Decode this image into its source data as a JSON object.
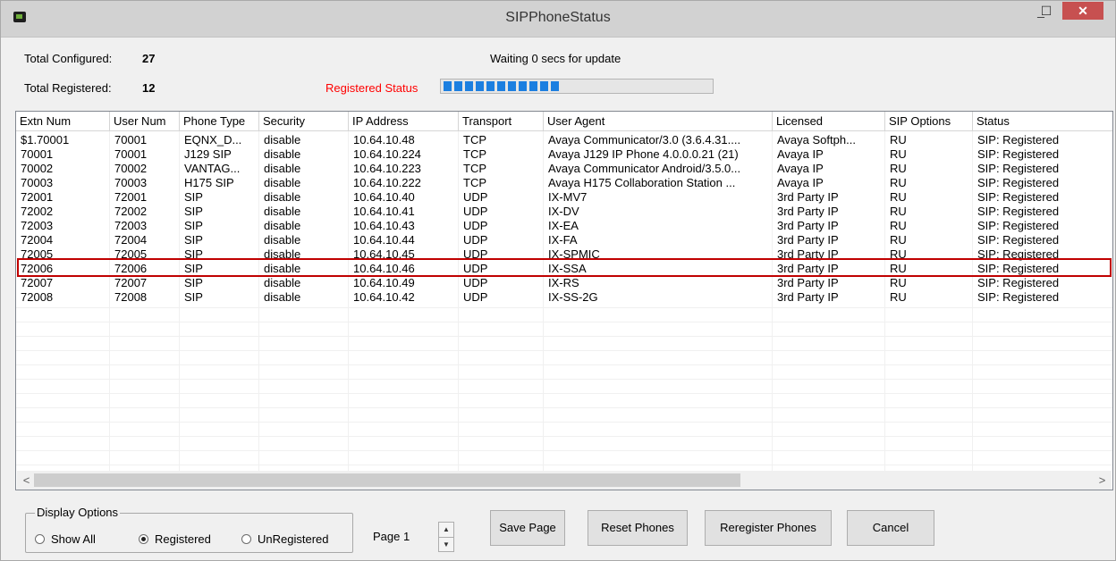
{
  "window": {
    "title": "SIPPhoneStatus",
    "minimize_glyph": "_",
    "maximize_glyph": "☐",
    "close_glyph": "✕"
  },
  "summary": {
    "total_configured_label": "Total Configured:",
    "total_configured_value": "27",
    "total_registered_label": "Total Registered:",
    "total_registered_value": "12",
    "waiting_text": "Waiting 0 secs for update",
    "registered_status_label": "Registered Status",
    "registered_status_color": "#ff0000",
    "progress_fraction": 0.44,
    "progress_color": "#1c7fe0"
  },
  "table": {
    "columns": [
      "Extn Num",
      "User Num",
      "Phone Type",
      "Security",
      "IP Address",
      "Transport",
      "User Agent",
      "Licensed",
      "SIP Options",
      "Status"
    ],
    "rows": [
      [
        "$1.70001",
        "70001",
        "EQNX_D...",
        "disable",
        "10.64.10.48",
        "TCP",
        "Avaya Communicator/3.0 (3.6.4.31....",
        "Avaya Softph...",
        "RU",
        "SIP: Registered"
      ],
      [
        "70001",
        "70001",
        "J129 SIP",
        "disable",
        "10.64.10.224",
        "TCP",
        "Avaya J129 IP Phone 4.0.0.0.21 (21)",
        "Avaya IP",
        "RU",
        "SIP: Registered"
      ],
      [
        "70002",
        "70002",
        "VANTAG...",
        "disable",
        "10.64.10.223",
        "TCP",
        "Avaya Communicator Android/3.5.0...",
        "Avaya IP",
        "RU",
        "SIP: Registered"
      ],
      [
        "70003",
        "70003",
        "H175 SIP",
        "disable",
        "10.64.10.222",
        "TCP",
        "Avaya H175 Collaboration Station ...",
        "Avaya IP",
        "RU",
        "SIP: Registered"
      ],
      [
        "72001",
        "72001",
        "SIP",
        "disable",
        "10.64.10.40",
        "UDP",
        "IX-MV7",
        "3rd Party IP",
        "RU",
        "SIP: Registered"
      ],
      [
        "72002",
        "72002",
        "SIP",
        "disable",
        "10.64.10.41",
        "UDP",
        "IX-DV",
        "3rd Party IP",
        "RU",
        "SIP: Registered"
      ],
      [
        "72003",
        "72003",
        "SIP",
        "disable",
        "10.64.10.43",
        "UDP",
        "IX-EA",
        "3rd Party IP",
        "RU",
        "SIP: Registered"
      ],
      [
        "72004",
        "72004",
        "SIP",
        "disable",
        "10.64.10.44",
        "UDP",
        "IX-FA",
        "3rd Party IP",
        "RU",
        "SIP: Registered"
      ],
      [
        "72005",
        "72005",
        "SIP",
        "disable",
        "10.64.10.45",
        "UDP",
        "IX-SPMIC",
        "3rd Party IP",
        "RU",
        "SIP: Registered"
      ],
      [
        "72006",
        "72006",
        "SIP",
        "disable",
        "10.64.10.46",
        "UDP",
        "IX-SSA",
        "3rd Party IP",
        "RU",
        "SIP: Registered"
      ],
      [
        "72007",
        "72007",
        "SIP",
        "disable",
        "10.64.10.49",
        "UDP",
        "IX-RS",
        "3rd Party IP",
        "RU",
        "SIP: Registered"
      ],
      [
        "72008",
        "72008",
        "SIP",
        "disable",
        "10.64.10.42",
        "UDP",
        "IX-SS-2G",
        "3rd Party IP",
        "RU",
        "SIP: Registered"
      ]
    ],
    "highlighted_row": "72006",
    "highlight_color": "#c00000"
  },
  "display_options": {
    "title": "Display Options",
    "options": [
      "Show All",
      "Registered",
      "UnRegistered"
    ],
    "selected": "Registered"
  },
  "pager": {
    "page_label": "Page 1",
    "up_glyph": "▲",
    "down_glyph": "▼"
  },
  "buttons": {
    "save_page": "Save Page",
    "reset_phones": "Reset Phones",
    "reregister_phones": "Reregister Phones",
    "cancel": "Cancel"
  },
  "scrollbar": {
    "left_glyph": "<",
    "right_glyph": ">"
  }
}
